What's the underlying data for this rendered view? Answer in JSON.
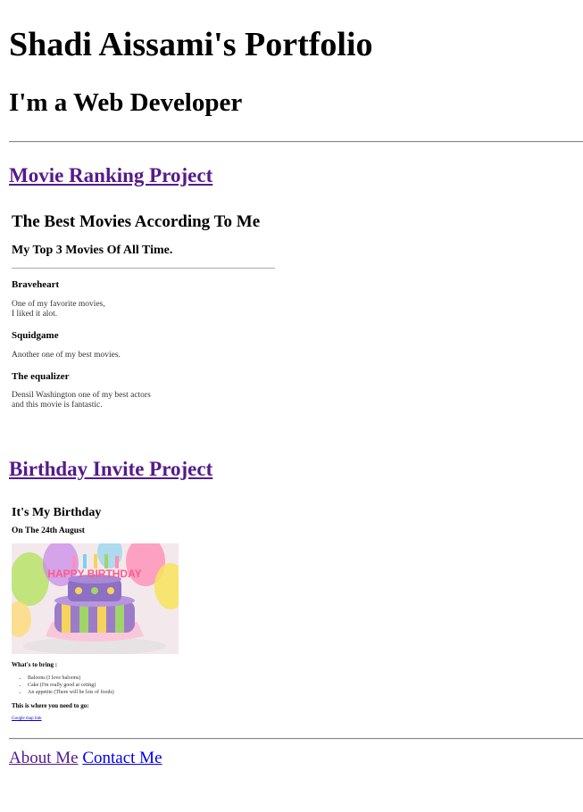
{
  "header": {
    "title": "Shadi Aissami's Portfolio",
    "subtitle": "I'm a Web Developer"
  },
  "projects": {
    "movie": {
      "link_label": "Movie Ranking Project",
      "title": "The Best Movies According To Me",
      "subtitle": "My Top 3 Movies Of All Time.",
      "movies": [
        {
          "name": "Braveheart",
          "desc_line1": "One of my favorite movies,",
          "desc_line2": "I liked it alot."
        },
        {
          "name": "Squidgame",
          "desc_line1": "Another one of my best movies.",
          "desc_line2": ""
        },
        {
          "name": "The equalizer",
          "desc_line1": "Densil Washington one of my best actors",
          "desc_line2": "and this movie is fantastic."
        }
      ]
    },
    "birthday": {
      "link_label": "Birthday Invite Project",
      "title": "It's My Birthday",
      "date": "On The 24th August",
      "image_text": "HAPPY BIRTHDAY",
      "bring_label": "What's to bring :",
      "bring_items": [
        "Baloons (I love baloons)",
        "Cake (I'm really good at ceting)",
        "An appetite (There will be lots of foods)"
      ],
      "where_label": "This is where you need to go:",
      "map_link": "Google map link"
    }
  },
  "footer": {
    "about": "About Me",
    "contact": "Contact Me"
  }
}
